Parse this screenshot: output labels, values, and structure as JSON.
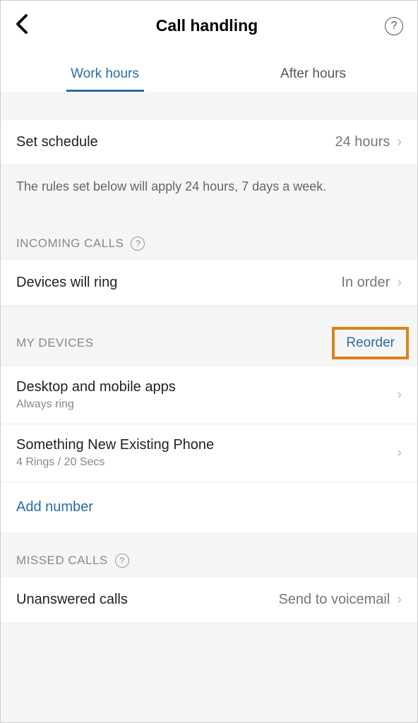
{
  "header": {
    "title": "Call handling"
  },
  "tabs": {
    "work_hours": "Work hours",
    "after_hours": "After hours"
  },
  "schedule": {
    "label": "Set schedule",
    "value": "24 hours"
  },
  "info_text": "The rules set below will apply 24 hours, 7 days a week.",
  "incoming": {
    "section_title": "INCOMING CALLS",
    "devices_ring_label": "Devices will ring",
    "devices_ring_value": "In order"
  },
  "my_devices": {
    "section_title": "MY DEVICES",
    "reorder": "Reorder",
    "items": [
      {
        "title": "Desktop and mobile apps",
        "subtitle": "Always ring"
      },
      {
        "title": "Something New Existing Phone",
        "subtitle": "4 Rings / 20 Secs"
      }
    ],
    "add_number": "Add number"
  },
  "missed": {
    "section_title": "MISSED CALLS",
    "unanswered_label": "Unanswered calls",
    "unanswered_value": "Send to voicemail"
  }
}
